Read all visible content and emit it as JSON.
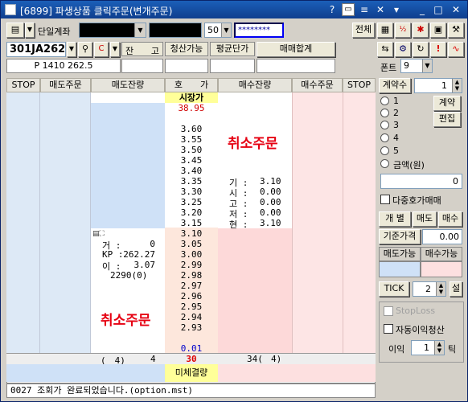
{
  "title": "[6899] 파생상품 클릭주문(변개주문)",
  "titlebar": {
    "help": "?",
    "min": "_",
    "max": "□",
    "close": "✕"
  },
  "toolbar": {
    "account_type": "단일계좌",
    "account_number": "",
    "account_name": "",
    "count_value": "50",
    "password": "********",
    "all_label": "전체"
  },
  "row2": {
    "symbol": "301JA262",
    "symbol_desc": "P 1410 262.5",
    "remain_label": "잔",
    "remain_label2": "고",
    "settle_label": "청산가능",
    "avg_price_label": "평균단가",
    "trade_sum_label": "매매합계",
    "font_label": "폰트",
    "font_size": "9"
  },
  "table": {
    "headers": [
      "STOP",
      "매도주문",
      "매도잔량",
      "호　　가",
      "매수잔량",
      "매수주문",
      "STOP"
    ],
    "market_price_label": "시장가",
    "top_price": "38.95",
    "upper_prices": [
      "3.60",
      "3.55",
      "3.50",
      "3.45",
      "3.40",
      "3.35",
      "3.30",
      "3.25",
      "3.20",
      "3.15"
    ],
    "lower_prices": [
      "3.10",
      "3.05",
      "3.00",
      "2.99",
      "2.98",
      "2.97",
      "2.96",
      "2.95",
      "2.94",
      "2.93"
    ],
    "bottom_price": "0.01",
    "cancel_label": "취소주문",
    "ohlc": [
      {
        "label": "기 :",
        "value": "3.10"
      },
      {
        "label": "시 :",
        "value": "0.00"
      },
      {
        "label": "고 :",
        "value": "0.00"
      },
      {
        "label": "저 :",
        "value": "0.00"
      },
      {
        "label": "현 :",
        "value": "3.10"
      }
    ],
    "stats": [
      {
        "label": "거 :",
        "value": "0"
      },
      {
        "label": "KP :",
        "value": "262.27"
      },
      {
        "label": "이 :",
        "value": "3.07"
      }
    ],
    "stat_extra": "2290(0)",
    "total_sell_count": "(　4)",
    "total_sell_qty": "4",
    "total_diff": "30",
    "total_buy_qty": "34(",
    "total_buy_count": "4)",
    "unfilled_label": "미체결량"
  },
  "status_text": "0027 조회가 완료되었습니다.(option.mst)",
  "right_panel": {
    "contract_label": "계약수",
    "contract_value": "1",
    "radios": [
      "1",
      "2",
      "3",
      "4",
      "5"
    ],
    "amount_label": "금액(원)",
    "amount_value": "0",
    "calc_label": "계약",
    "edit_label": "편집",
    "multi_price_label": "다중호가매매",
    "individual_label": "개 별",
    "sell_label": "매도",
    "buy_label": "매수",
    "base_price_label": "기준가격",
    "base_price_value": "0.00",
    "sell_avail_label": "매도가능",
    "buy_avail_label": "매수가능",
    "tick_label": "TICK",
    "tick_value": "2",
    "setting_label": "설",
    "stoploss_label": "StopLoss",
    "auto_profit_label": "자동이익청산",
    "profit_label": "이익",
    "profit_value": "1",
    "tick_unit": "틱"
  }
}
